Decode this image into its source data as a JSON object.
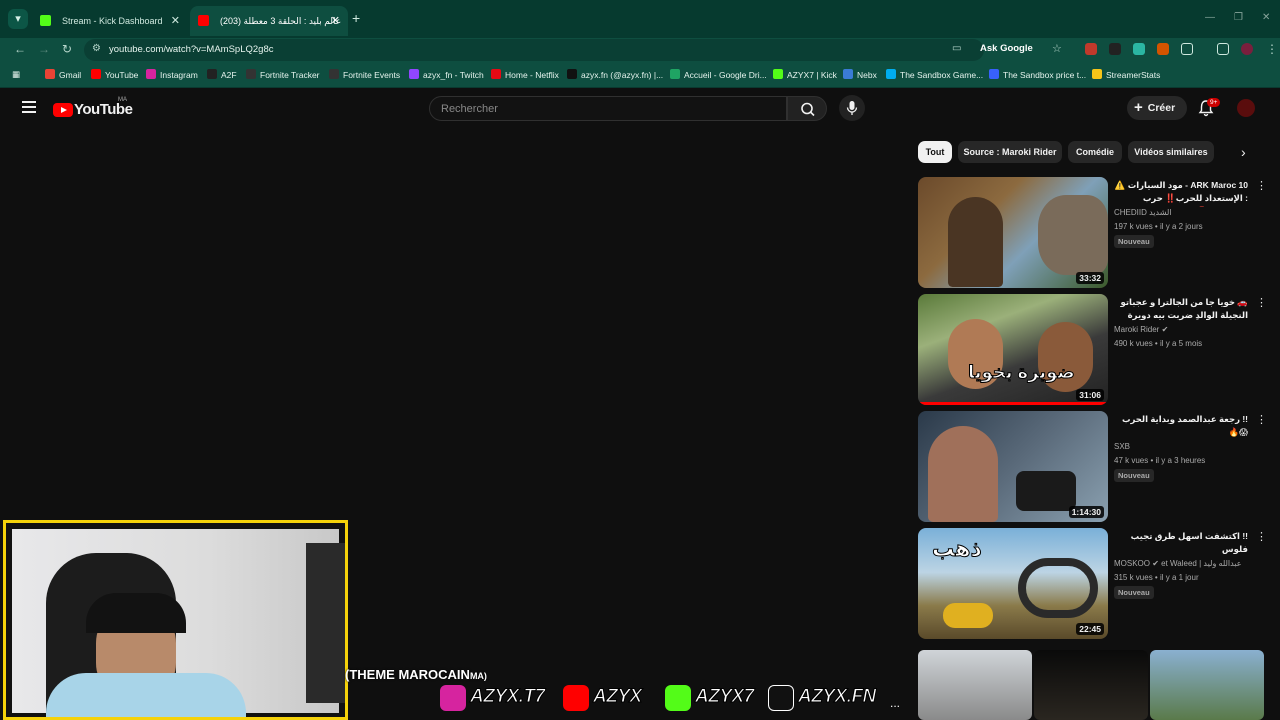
{
  "browser": {
    "tabs": [
      {
        "label": "Stream - Kick Dashboard",
        "favicon_color": "#53fc18"
      },
      {
        "label": "عالم بليد : الحلقة 3 معطلة (203)",
        "favicon_color": "#ff0000"
      }
    ],
    "url": "youtube.com/watch?v=MAmSpLQ2g8c",
    "ask_google": "Ask Google",
    "bookmarks": [
      {
        "label": "Gmail",
        "color": "#ea4335"
      },
      {
        "label": "YouTube",
        "color": "#ff0000"
      },
      {
        "label": "Instagram",
        "color": "#d6249f"
      },
      {
        "label": "A2F",
        "color": "#222222"
      },
      {
        "label": "Fortnite Tracker",
        "color": "#333333"
      },
      {
        "label": "Fortnite Events",
        "color": "#333333"
      },
      {
        "label": "azyx_fn - Twitch",
        "color": "#9146ff"
      },
      {
        "label": "Home - Netflix",
        "color": "#e50914"
      },
      {
        "label": "azyx.fn (@azyx.fn) |...",
        "color": "#111111"
      },
      {
        "label": "Accueil - Google Dri...",
        "color": "#1fa463"
      },
      {
        "label": "AZYX7 | Kick",
        "color": "#53fc18"
      },
      {
        "label": "Nebx",
        "color": "#3a7bd5"
      },
      {
        "label": "The Sandbox Game...",
        "color": "#00adef"
      },
      {
        "label": "The Sandbox price t...",
        "color": "#3861fb"
      },
      {
        "label": "StreamerStats",
        "color": "#f5c518"
      }
    ]
  },
  "youtube": {
    "logo_text": "YouTube",
    "region": "MA",
    "search_placeholder": "Rechercher",
    "create_label": "Créer",
    "notif_badge": "9+",
    "chips": [
      "Tout",
      "Source : Maroki Rider",
      "Comédie",
      "Vidéos similaires"
    ],
    "videos": [
      {
        "title": "ARK Maroc 10 - مود السيارات ⚠️ : الإستعداد للحرب‼️ حرب المسالحة 🚨 ...",
        "channel": "CHEDIID الشديد",
        "meta": "197 k vues • il y a 2 jours",
        "badge": "Nouveau",
        "duration": "33:32"
      },
      {
        "title": "🚗 خويا جا من الجالترا و عجباتو النجيلة الوالدِ ضربت بيه دويرة كعلو ليا 😂...",
        "channel": "Maroki Rider ✔",
        "meta": "490 k vues • il y a 5 mois",
        "badge": "",
        "duration": "31:06"
      },
      {
        "title": "!! رجعة عبدالصمد وبداية الحرب 😱🔥",
        "channel": "SXB",
        "meta": "47 k vues • il y a 3 heures",
        "badge": "Nouveau",
        "duration": "1:14:30"
      },
      {
        "title": "!! اكتشفت اسهل طرق تجيب فلوس",
        "channel": "MOSKOO ✔ et Waleed | عبدالله وليد",
        "meta": "315 k vues • il y a 1 jour",
        "badge": "Nouveau",
        "duration": "22:45"
      }
    ]
  },
  "overlay": {
    "theme_text": "(THEME MAROCAIN",
    "theme_suffix": "MA)",
    "socials": [
      {
        "handle": "AZYX.T7",
        "platform": "instagram-icon",
        "color": "#d6249f"
      },
      {
        "handle": "AZYX",
        "platform": "youtube-icon",
        "color": "#ff0000"
      },
      {
        "handle": "AZYX7",
        "platform": "kick-icon",
        "color": "#53fc18"
      },
      {
        "handle": "AZYX.FN",
        "platform": "tiktok-icon",
        "color": "#111111"
      }
    ],
    "more": "..."
  }
}
